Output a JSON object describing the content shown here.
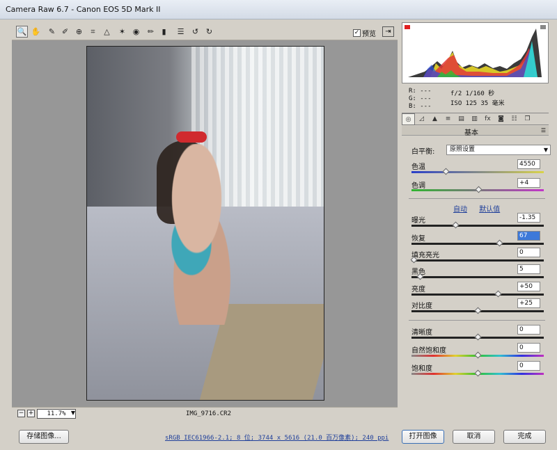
{
  "window": {
    "title": "Camera Raw 6.7 -  Canon EOS 5D Mark II"
  },
  "toolbar": {
    "tools": [
      "zoom-tool-icon",
      "hand-tool-icon",
      "white-balance-icon",
      "color-sampler-icon",
      "target-adjust-icon",
      "crop-icon",
      "straighten-icon",
      "spot-removal-icon",
      "red-eye-icon",
      "adjustment-brush-icon",
      "graduated-filter-icon",
      "preferences-icon",
      "rotate-left-icon",
      "rotate-right-icon"
    ],
    "preview_label": "预览",
    "preview_checked": true
  },
  "canvas": {
    "zoom": "11.7%",
    "filename": "IMG_9716.CR2"
  },
  "readout": {
    "r": "R:  ---",
    "g": "G:  ---",
    "b": "B:  ---",
    "aperture_shutter": "f/2   1/160 秒",
    "iso_focal": "ISO 125   35 毫米"
  },
  "panel": {
    "title": "基本",
    "white_balance_label": "白平衡:",
    "white_balance_value": "原照设置",
    "temperature": {
      "label": "色温",
      "value": "4550",
      "position": 0.25
    },
    "tint": {
      "label": "色调",
      "value": "+4",
      "position": 0.51
    },
    "auto_link": "自动",
    "default_link": "默认值",
    "exposure": {
      "label": "曝光",
      "value": "-1.35",
      "position": 0.33
    },
    "recovery": {
      "label": "恢复",
      "value": "67",
      "position": 0.67
    },
    "fill_light": {
      "label": "填充亮光",
      "value": "0",
      "position": 0.0
    },
    "blacks": {
      "label": "黑色",
      "value": "5",
      "position": 0.05
    },
    "brightness": {
      "label": "亮度",
      "value": "+50",
      "position": 0.66
    },
    "contrast": {
      "label": "对比度",
      "value": "+25",
      "position": 0.5
    },
    "clarity": {
      "label": "清晰度",
      "value": "0",
      "position": 0.5
    },
    "vibrance": {
      "label": "自然饱和度",
      "value": "0",
      "position": 0.5
    },
    "saturation": {
      "label": "饱和度",
      "value": "0",
      "position": 0.5
    }
  },
  "bottom": {
    "save_button": "存储图像...",
    "workflow_info": "sRGB IEC61966-2.1; 8 位; 3744 x 5616 (21.0 百万像素); 240 ppi",
    "open_button": "打开图像",
    "cancel_button": "取消",
    "done_button": "完成"
  }
}
